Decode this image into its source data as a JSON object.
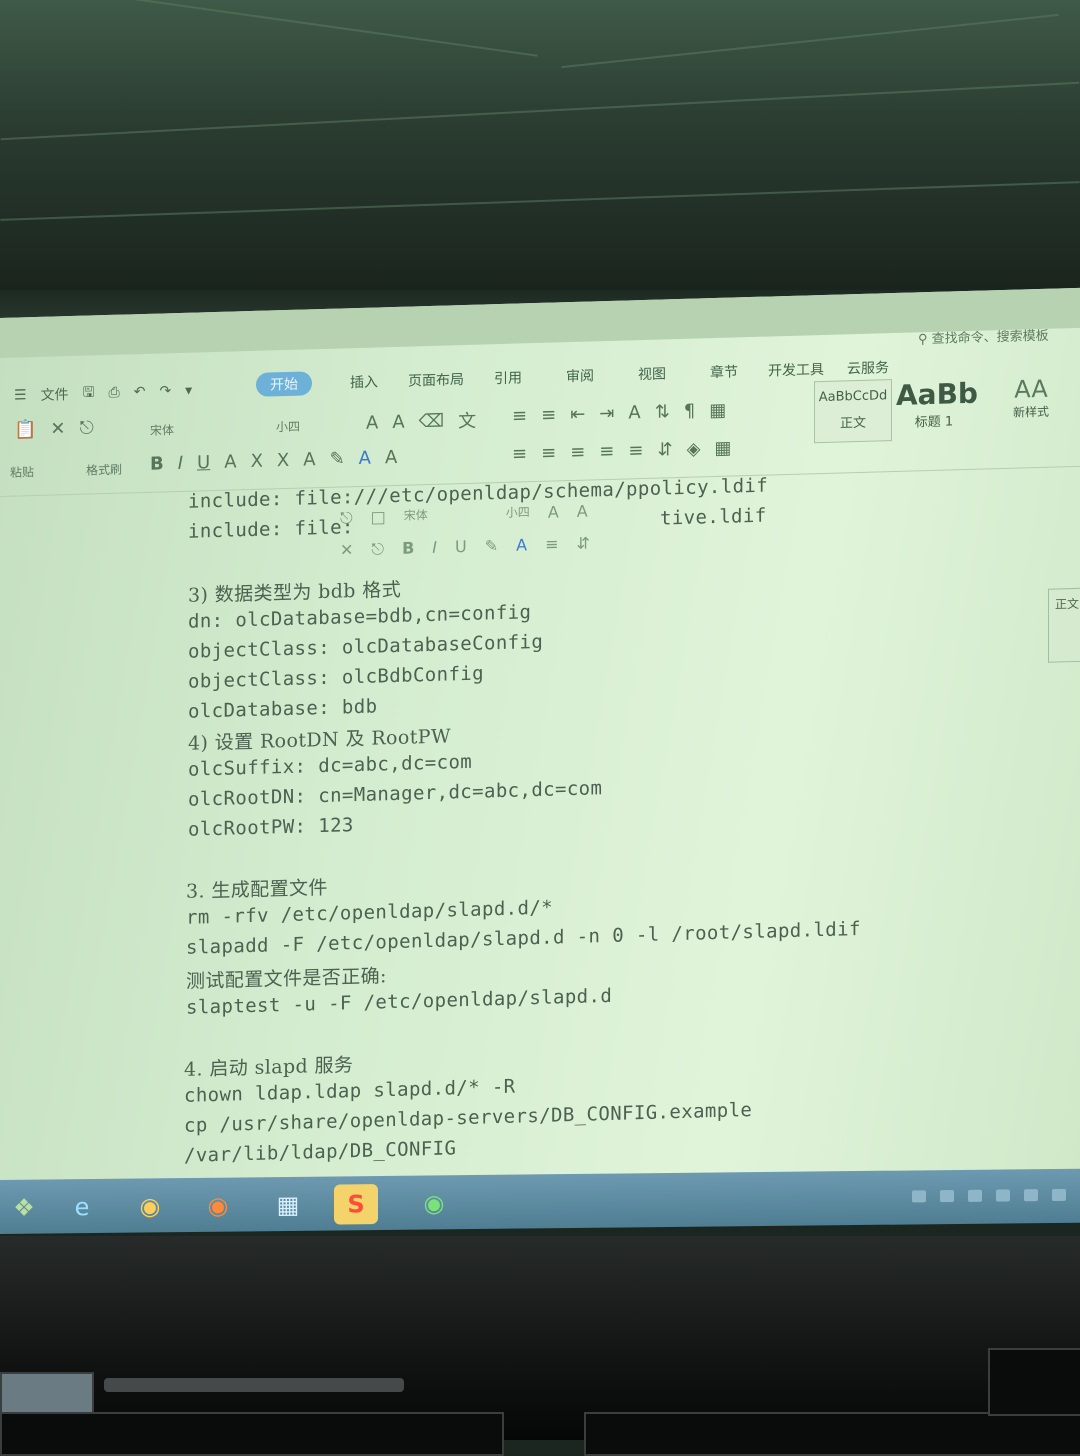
{
  "ribbon": {
    "file_menu": "文件",
    "tabs": [
      "开始",
      "插入",
      "页面布局",
      "引用",
      "审阅",
      "视图",
      "章节",
      "开发工具",
      "云服务"
    ],
    "search_placeholder": "查找命令、搜索模板",
    "paste_label": "粘贴",
    "format_painter_label": "格式刷",
    "font_name": "宋体",
    "font_size": "小四",
    "style_normal_preview": "AaBbCcDd",
    "style_normal_label": "正文",
    "style_heading_preview": "AaBb",
    "style_heading_label": "标题 1",
    "new_style_label": "新样式",
    "new_style_preview": "AA"
  },
  "floating_toolbar": {
    "font_name": "宋体",
    "font_size": "小四"
  },
  "document": {
    "lines": [
      "include: file:///etc/openldap/schema/ppolicy.ldif",
      "include: file:",
      "tive.ldif",
      "3) 数据类型为 bdb 格式",
      "dn: olcDatabase=bdb,cn=config",
      "objectClass: olcDatabaseConfig",
      "objectClass: olcBdbConfig",
      "olcDatabase: bdb",
      "4) 设置 RootDN 及 RootPW",
      "olcSuffix: dc=abc,dc=com",
      "olcRootDN: cn=Manager,dc=abc,dc=com",
      "olcRootPW: 123",
      "3. 生成配置文件",
      "rm -rfv /etc/openldap/slapd.d/*",
      "slapadd -F /etc/openldap/slapd.d -n 0 -l /root/slapd.ldif",
      "测试配置文件是否正确:",
      "slaptest -u -F /etc/openldap/slapd.d",
      "4. 启动 slapd 服务",
      "chown ldap.ldap slapd.d/* -R",
      "cp /usr/share/openldap-servers/DB_CONFIG.example",
      "/var/lib/ldap/DB_CONFIG"
    ]
  },
  "side_panel": {
    "label": "正文"
  },
  "colors": {
    "screen": "#d4eccf",
    "text": "#4c6150",
    "active_tab": "#6db1d8",
    "taskbar": "#5f8ca2"
  },
  "taskbar": {
    "icons": [
      "start-orb-icon",
      "ie-icon",
      "chrome-icon",
      "firefox-icon",
      "explorer-icon",
      "wps-icon",
      "globe-icon"
    ]
  }
}
